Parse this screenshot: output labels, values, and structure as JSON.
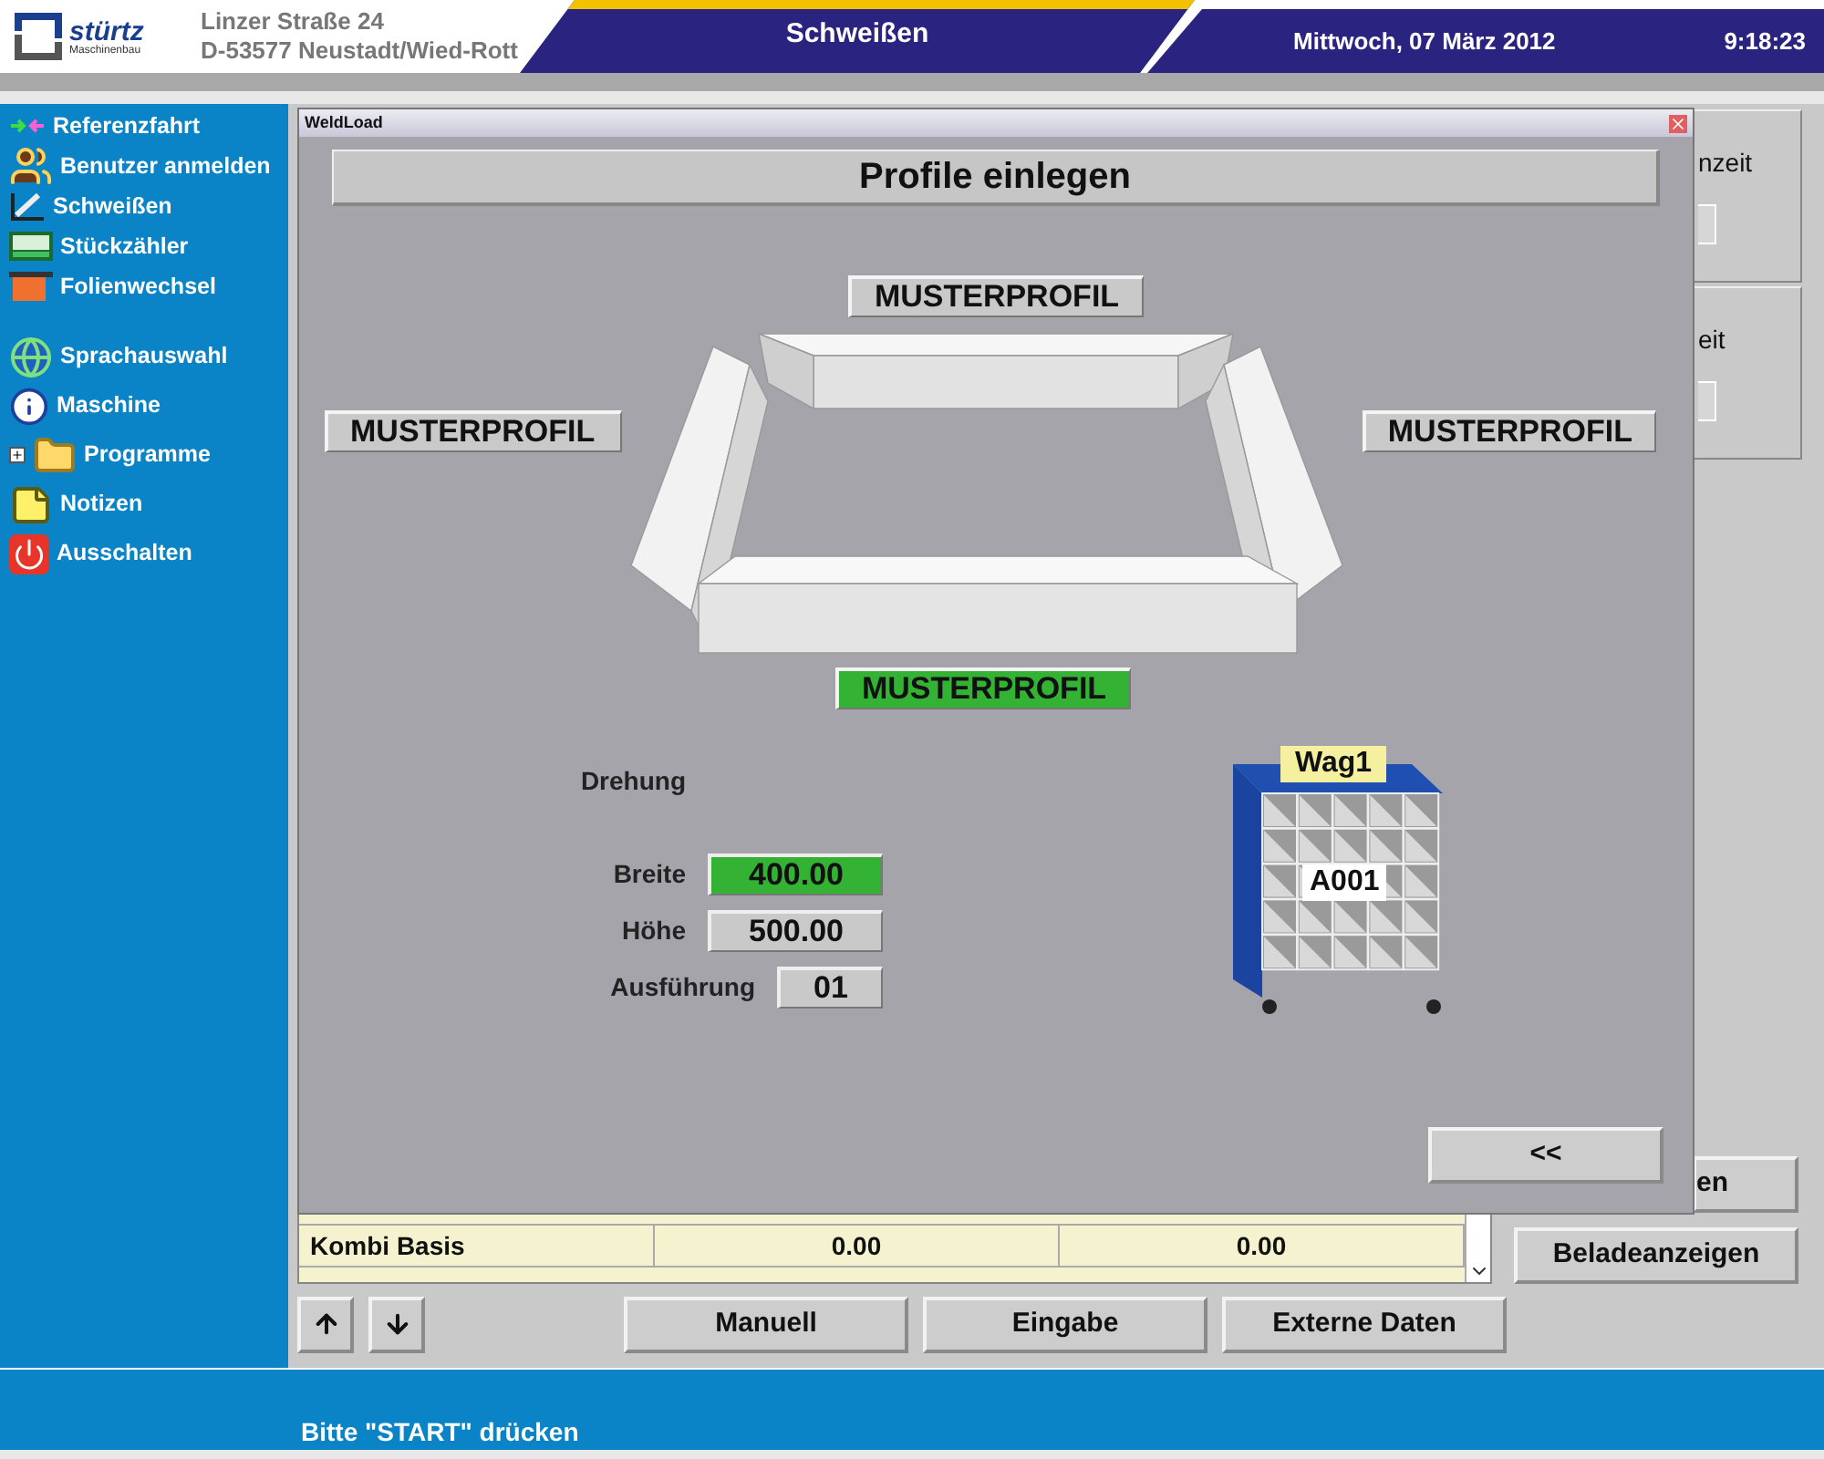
{
  "header": {
    "logo_name": "stürtz",
    "logo_subtitle": "Maschinenbau",
    "address_line1": "Linzer Straße 24",
    "address_line2": "D-53577 Neustadt/Wied-Rott",
    "title": "Schweißen",
    "date": "Mittwoch, 07 März 2012",
    "time": "9:18:23"
  },
  "sidebar": {
    "items": [
      {
        "label": "Referenzfahrt",
        "kind": "arrows"
      },
      {
        "label": "Benutzer anmelden",
        "kind": "users"
      },
      {
        "label": "Schweißen",
        "kind": "weld"
      },
      {
        "label": "Stückzähler",
        "kind": "counter"
      },
      {
        "label": "Folienwechsel",
        "kind": "foil"
      },
      {
        "label": "Sprachauswahl",
        "kind": "globe"
      },
      {
        "label": "Maschine",
        "kind": "info"
      },
      {
        "label": "Programme",
        "kind": "folder",
        "expandable": true
      },
      {
        "label": "Notizen",
        "kind": "note"
      },
      {
        "label": "Ausschalten",
        "kind": "power"
      }
    ]
  },
  "background": {
    "panels": [
      {
        "label": "nzeit"
      },
      {
        "label": "eit"
      }
    ],
    "side_buttons": [
      "en",
      "Beladeanzeigen"
    ],
    "table": {
      "rows": [
        [
          "Kombi Basis",
          "0.00",
          "0.00"
        ]
      ]
    },
    "toolbar": [
      "Manuell",
      "Eingabe",
      "Externe Daten"
    ]
  },
  "dialog": {
    "title": "WeldLoad",
    "heading": "Profile einlegen",
    "profiles": [
      {
        "label": "MUSTERPROFIL",
        "highlighted": false
      },
      {
        "label": "MUSTERPROFIL",
        "highlighted": false
      },
      {
        "label": "MUSTERPROFIL",
        "highlighted": false
      },
      {
        "label": "MUSTERPROFIL",
        "highlighted": true
      }
    ],
    "fields": [
      {
        "label": "Drehung"
      },
      {
        "label": "Breite",
        "value": "400.00",
        "highlighted": true
      },
      {
        "label": "Höhe",
        "value": "500.00",
        "highlighted": false
      },
      {
        "label": "Ausführung",
        "value": "01",
        "highlighted": false
      }
    ],
    "cart": {
      "label": "Wag1",
      "slot": "A001"
    },
    "back_button": "<<"
  },
  "status_bar": {
    "message": "Bitte \"START\" drücken"
  }
}
